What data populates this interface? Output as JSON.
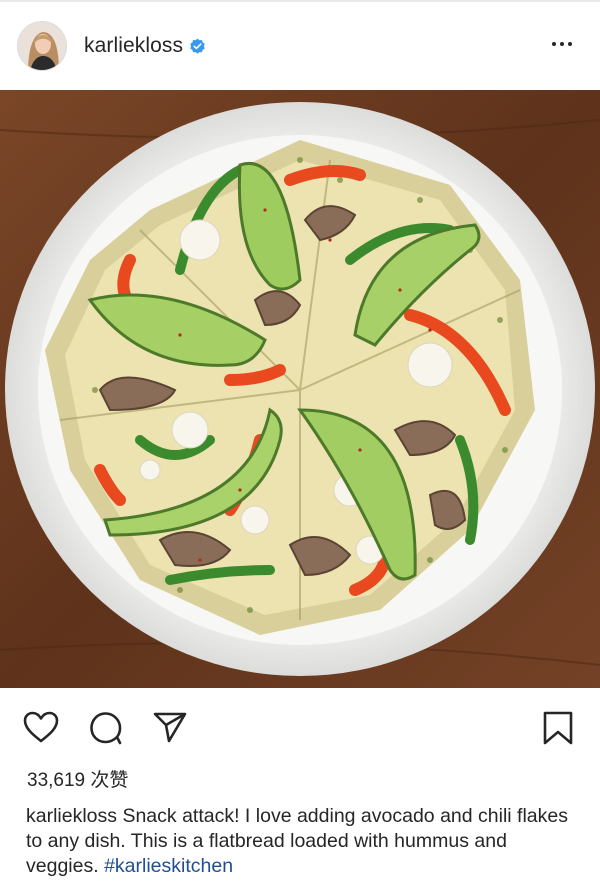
{
  "post": {
    "username": "karliekloss",
    "verified": true,
    "more_icon": "ellipsis-icon",
    "image_alt": "flatbread with hummus, avocado, mushrooms, peppers and cauliflower on a white plate"
  },
  "actions": {
    "like_icon": "heart-icon",
    "comment_icon": "comment-icon",
    "share_icon": "send-icon",
    "save_icon": "bookmark-icon"
  },
  "likes": {
    "text": "33,619 次赞"
  },
  "caption": {
    "username": "karliekloss",
    "text": "Snack attack! I love adding avocado and chili flakes to any dish.  This is a flatbread loaded with hummus and veggies.",
    "hashtag": "#karlieskitchen"
  },
  "colors": {
    "hashtag": "#1e4f94",
    "verified_badge": "#3897f0",
    "text": "#262626"
  }
}
